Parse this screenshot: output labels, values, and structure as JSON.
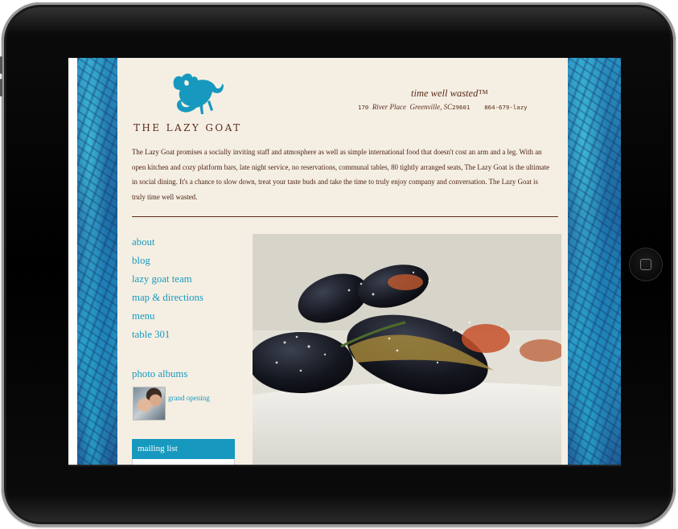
{
  "site": {
    "logo_text": "THE LAZY GOAT",
    "tagline": "time well wasted™",
    "address_number": "170",
    "address_street": "River Place",
    "address_city": "Greenville, SC",
    "address_zip": "29601",
    "phone": "864-679-lazy"
  },
  "intro": "The Lazy Goat promises a socially inviting staff and atmosphere as well as simple international food that doesn't cost an arm and a leg. With an open kitchen and cozy platform bars, late night service, no reservations, communal tables, 80 tightly arranged seats, The Lazy Goat is the ultimate in social dining. It's a chance to slow down, treat your taste buds and take the time to truly enjoy company and conversation. The Lazy Goat is truly time well wasted.",
  "nav": {
    "items": [
      {
        "label": "about"
      },
      {
        "label": "blog"
      },
      {
        "label": "lazy goat team"
      },
      {
        "label": "map & directions"
      },
      {
        "label": "menu"
      },
      {
        "label": "table 301"
      }
    ]
  },
  "albums": {
    "title": "photo albums",
    "items": [
      {
        "label": "grand opening"
      }
    ]
  },
  "mailing": {
    "title": "mailing list"
  },
  "colors": {
    "accent": "#1799bf",
    "text": "#5b2a1a",
    "background": "#f5efe3"
  }
}
